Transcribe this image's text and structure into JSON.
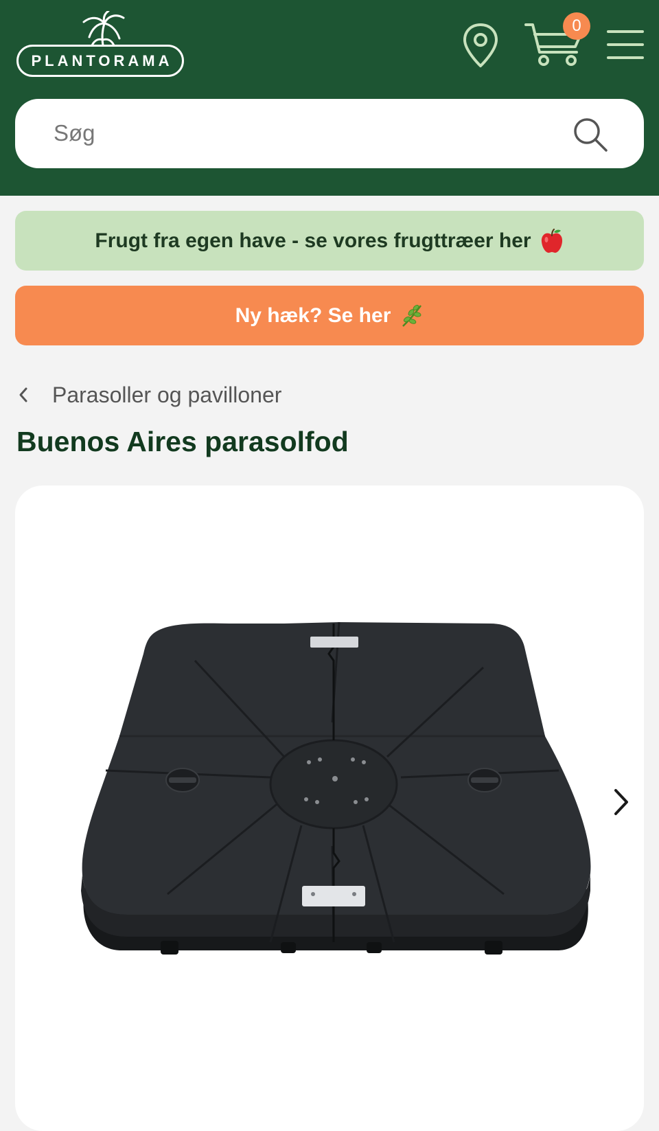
{
  "header": {
    "logo_text": "PLANTORAMA",
    "cart_count": "0",
    "icons": [
      "palm-tree-icon",
      "location-pin-icon",
      "shopping-cart-icon",
      "hamburger-menu-icon",
      "search-icon"
    ]
  },
  "search": {
    "placeholder": "Søg"
  },
  "banners": {
    "fruit": "Frugt fra egen have - se vores frugttræer her",
    "hedge": "Ny hæk? Se her"
  },
  "breadcrumb": {
    "label": "Parasoller og pavilloner"
  },
  "product": {
    "title": "Buenos Aires parasolfod"
  },
  "colors": {
    "header_green": "#1d5533",
    "banner_green": "#c8e2bd",
    "banner_orange": "#f78a50",
    "title_green": "#123a1f"
  }
}
